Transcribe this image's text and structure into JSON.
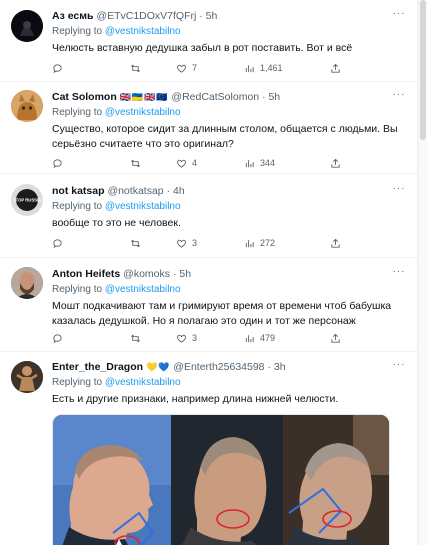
{
  "tweets": [
    {
      "name": "Аз есмь",
      "handle": "@ETvC1DOxV7fQFrj",
      "time": "5h",
      "replying_prefix": "Replying to",
      "replying_to": "@vestnikstabilno",
      "text": "Челюсть вставную дедушка забыл в рот поставить. Вот и всё",
      "reply_count": "",
      "retweet_count": "",
      "like_count": "7",
      "view_count": "1,461"
    },
    {
      "name": "Cat Solomon",
      "flags": "🇬🇧🇺🇦🇬🇧🇪🇺",
      "handle": "@RedCatSolomon",
      "time": "5h",
      "replying_prefix": "Replying to",
      "replying_to": "@vestnikstabilno",
      "text": "Существо, которое сидит за длинным столом, общается с людьми. Вы серьёзно считаете что это оригинал?",
      "reply_count": "",
      "retweet_count": "",
      "like_count": "4",
      "view_count": "344"
    },
    {
      "name": "not katsap",
      "handle": "@notkatsap",
      "time": "4h",
      "replying_prefix": "Replying to",
      "replying_to": "@vestnikstabilno",
      "text": "вообще то это не человек.",
      "avatar_text": "STOP RUSSIA",
      "reply_count": "",
      "retweet_count": "",
      "like_count": "3",
      "view_count": "272"
    },
    {
      "name": "Anton Heifets",
      "handle": "@komoks",
      "time": "5h",
      "replying_prefix": "Replying to",
      "replying_to": "@vestnikstabilno",
      "text": "Мошт подкачивают там и гримируют время от времени чтоб бабушка казалась дедушкой. Но я полагаю это один и тот же персонаж",
      "reply_count": "",
      "retweet_count": "",
      "like_count": "3",
      "view_count": "479"
    },
    {
      "name": "Enter_the_Dragon",
      "badges": "💛💙",
      "handle": "@Enterth25634598",
      "time": "3h",
      "replying_prefix": "Replying to",
      "replying_to": "@vestnikstabilno",
      "text": "Есть и другие признаки, например длина нижней челюсти."
    }
  ],
  "separator": "·",
  "more_glyph": "···",
  "colors": {
    "accent": "#1d9bf0",
    "secondary_text": "#536471",
    "annotation_red": "#e0242b",
    "annotation_blue": "#2f6fe4"
  }
}
